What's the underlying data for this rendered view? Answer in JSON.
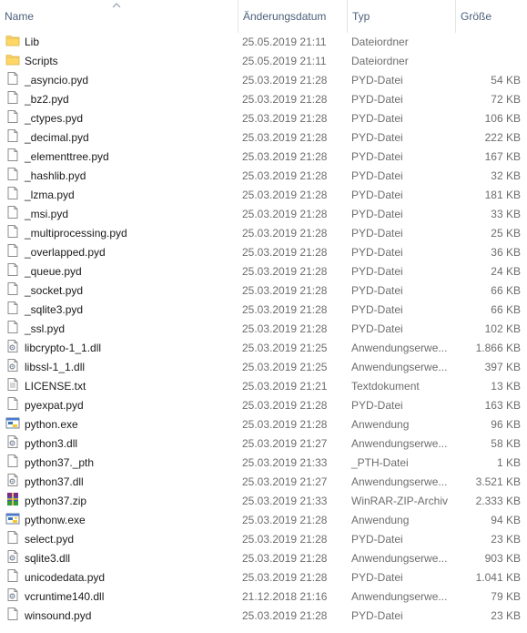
{
  "columns": {
    "name": "Name",
    "date": "Änderungsdatum",
    "type": "Typ",
    "size": "Größe"
  },
  "sort": {
    "column": "name",
    "icon": "sort-up-chevron-icon"
  },
  "files": [
    {
      "name": "Lib",
      "date": "25.05.2019 21:11",
      "type": "Dateiordner",
      "size": "",
      "icon": "folder-icon"
    },
    {
      "name": "Scripts",
      "date": "25.05.2019 21:11",
      "type": "Dateiordner",
      "size": "",
      "icon": "folder-icon"
    },
    {
      "name": "_asyncio.pyd",
      "date": "25.03.2019 21:28",
      "type": "PYD-Datei",
      "size": "54 KB",
      "icon": "file-icon"
    },
    {
      "name": "_bz2.pyd",
      "date": "25.03.2019 21:28",
      "type": "PYD-Datei",
      "size": "72 KB",
      "icon": "file-icon"
    },
    {
      "name": "_ctypes.pyd",
      "date": "25.03.2019 21:28",
      "type": "PYD-Datei",
      "size": "106 KB",
      "icon": "file-icon"
    },
    {
      "name": "_decimal.pyd",
      "date": "25.03.2019 21:28",
      "type": "PYD-Datei",
      "size": "222 KB",
      "icon": "file-icon"
    },
    {
      "name": "_elementtree.pyd",
      "date": "25.03.2019 21:28",
      "type": "PYD-Datei",
      "size": "167 KB",
      "icon": "file-icon"
    },
    {
      "name": "_hashlib.pyd",
      "date": "25.03.2019 21:28",
      "type": "PYD-Datei",
      "size": "32 KB",
      "icon": "file-icon"
    },
    {
      "name": "_lzma.pyd",
      "date": "25.03.2019 21:28",
      "type": "PYD-Datei",
      "size": "181 KB",
      "icon": "file-icon"
    },
    {
      "name": "_msi.pyd",
      "date": "25.03.2019 21:28",
      "type": "PYD-Datei",
      "size": "33 KB",
      "icon": "file-icon"
    },
    {
      "name": "_multiprocessing.pyd",
      "date": "25.03.2019 21:28",
      "type": "PYD-Datei",
      "size": "25 KB",
      "icon": "file-icon"
    },
    {
      "name": "_overlapped.pyd",
      "date": "25.03.2019 21:28",
      "type": "PYD-Datei",
      "size": "36 KB",
      "icon": "file-icon"
    },
    {
      "name": "_queue.pyd",
      "date": "25.03.2019 21:28",
      "type": "PYD-Datei",
      "size": "24 KB",
      "icon": "file-icon"
    },
    {
      "name": "_socket.pyd",
      "date": "25.03.2019 21:28",
      "type": "PYD-Datei",
      "size": "66 KB",
      "icon": "file-icon"
    },
    {
      "name": "_sqlite3.pyd",
      "date": "25.03.2019 21:28",
      "type": "PYD-Datei",
      "size": "66 KB",
      "icon": "file-icon"
    },
    {
      "name": "_ssl.pyd",
      "date": "25.03.2019 21:28",
      "type": "PYD-Datei",
      "size": "102 KB",
      "icon": "file-icon"
    },
    {
      "name": "libcrypto-1_1.dll",
      "date": "25.03.2019 21:25",
      "type": "Anwendungserwe...",
      "size": "1.866 KB",
      "icon": "dll-icon"
    },
    {
      "name": "libssl-1_1.dll",
      "date": "25.03.2019 21:25",
      "type": "Anwendungserwe...",
      "size": "397 KB",
      "icon": "dll-icon"
    },
    {
      "name": "LICENSE.txt",
      "date": "25.03.2019 21:21",
      "type": "Textdokument",
      "size": "13 KB",
      "icon": "text-file-icon"
    },
    {
      "name": "pyexpat.pyd",
      "date": "25.03.2019 21:28",
      "type": "PYD-Datei",
      "size": "163 KB",
      "icon": "file-icon"
    },
    {
      "name": "python.exe",
      "date": "25.03.2019 21:28",
      "type": "Anwendung",
      "size": "96 KB",
      "icon": "python-exe-icon"
    },
    {
      "name": "python3.dll",
      "date": "25.03.2019 21:27",
      "type": "Anwendungserwe...",
      "size": "58 KB",
      "icon": "dll-icon"
    },
    {
      "name": "python37._pth",
      "date": "25.03.2019 21:33",
      "type": "_PTH-Datei",
      "size": "1 KB",
      "icon": "file-icon"
    },
    {
      "name": "python37.dll",
      "date": "25.03.2019 21:27",
      "type": "Anwendungserwe...",
      "size": "3.521 KB",
      "icon": "dll-icon"
    },
    {
      "name": "python37.zip",
      "date": "25.03.2019 21:33",
      "type": "WinRAR-ZIP-Archiv",
      "size": "2.333 KB",
      "icon": "winrar-archive-icon"
    },
    {
      "name": "pythonw.exe",
      "date": "25.03.2019 21:28",
      "type": "Anwendung",
      "size": "94 KB",
      "icon": "pythonw-exe-icon"
    },
    {
      "name": "select.pyd",
      "date": "25.03.2019 21:28",
      "type": "PYD-Datei",
      "size": "23 KB",
      "icon": "file-icon"
    },
    {
      "name": "sqlite3.dll",
      "date": "25.03.2019 21:28",
      "type": "Anwendungserwe...",
      "size": "903 KB",
      "icon": "dll-icon"
    },
    {
      "name": "unicodedata.pyd",
      "date": "25.03.2019 21:28",
      "type": "PYD-Datei",
      "size": "1.041 KB",
      "icon": "file-icon"
    },
    {
      "name": "vcruntime140.dll",
      "date": "21.12.2018 21:16",
      "type": "Anwendungserwe...",
      "size": "79 KB",
      "icon": "dll-icon"
    },
    {
      "name": "winsound.pyd",
      "date": "25.03.2019 21:28",
      "type": "PYD-Datei",
      "size": "23 KB",
      "icon": "file-icon"
    }
  ],
  "colors": {
    "header_text": "#4c607a",
    "name_text": "#1a1a1a",
    "meta_text": "#6d6d6d",
    "folder_yellow": "#f8d775",
    "column_separator": "#e5e5e5"
  }
}
